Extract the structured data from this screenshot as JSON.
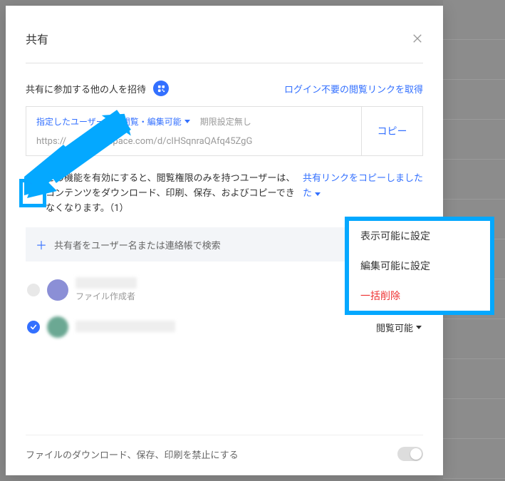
{
  "modal": {
    "title": "共有",
    "invite_label": "共有に参加する他の人を招待",
    "login_link_label": "ログイン不要の閲覧リンクを取得",
    "link": {
      "setting": "指定したユーザーのみ閲覧・編集可能",
      "expiry": "期限設定無し",
      "url": "https://　　　　kspace.com/d/cIHSqnraQAfq45ZgG",
      "copy_label": "コピー"
    },
    "note": "この機能を有効にすると、閲覧権限のみを持つユーザーは、コンテンツをダウンロード、印刷、保存、およびコピーできなくなります。（1）",
    "shared_link_status": "共有リンクをコピーしました",
    "search_placeholder": "共有者をユーザー名または連絡帳で検索",
    "users": [
      {
        "role": "ファイル作成者",
        "perm": ""
      },
      {
        "role": "",
        "perm": "閲覧可能"
      }
    ],
    "footer_label": "ファイルのダウンロード、保存、印刷を禁止にする"
  },
  "menu": {
    "view": "表示可能に設定",
    "edit": "編集可能に設定",
    "delete": "一括削除"
  }
}
